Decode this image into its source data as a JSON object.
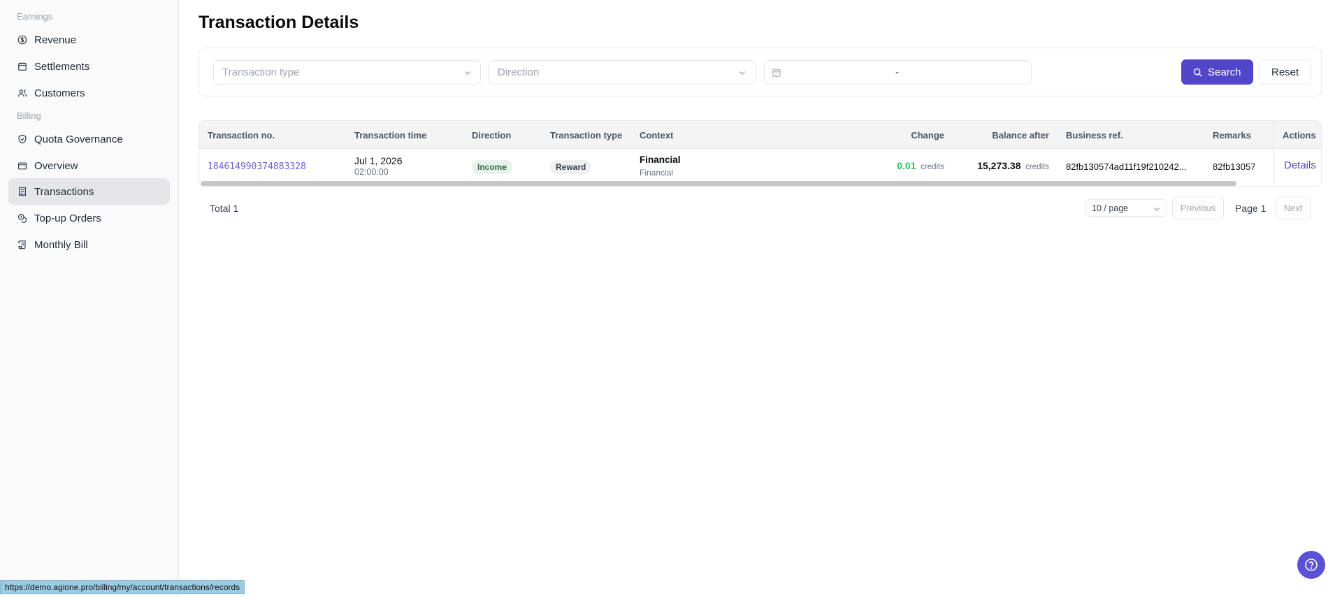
{
  "sidebar": {
    "sections": [
      {
        "label": "Earnings",
        "items": [
          {
            "label": "Revenue",
            "icon": "dollar-circle-icon"
          },
          {
            "label": "Settlements",
            "icon": "calendar-icon"
          },
          {
            "label": "Customers",
            "icon": "users-icon"
          }
        ]
      },
      {
        "label": "Billing",
        "items": [
          {
            "label": "Quota Governance",
            "icon": "shield-check-icon"
          },
          {
            "label": "Overview",
            "icon": "wallet-icon"
          },
          {
            "label": "Transactions",
            "icon": "receipt-icon",
            "active": true
          },
          {
            "label": "Top-up Orders",
            "icon": "coins-icon"
          },
          {
            "label": "Monthly Bill",
            "icon": "scroll-icon"
          }
        ]
      }
    ]
  },
  "page": {
    "title": "Transaction Details"
  },
  "filters": {
    "transaction_type_placeholder": "Transaction type",
    "direction_placeholder": "Direction",
    "date_separator": "-",
    "search_label": "Search",
    "reset_label": "Reset"
  },
  "table": {
    "headers": {
      "no": "Transaction no.",
      "time": "Transaction time",
      "direction": "Direction",
      "type": "Transaction type",
      "context": "Context",
      "change": "Change",
      "balance": "Balance after",
      "business_ref": "Business ref.",
      "remarks": "Remarks",
      "actions": "Actions"
    },
    "rows": [
      {
        "no": "184614990374883328",
        "date": "Jul 1, 2026",
        "time": "02:00:00",
        "direction": "Income",
        "type": "Reward",
        "context_title": "Financial",
        "context_sub": "Financial",
        "change": "0.01",
        "change_unit": "credits",
        "balance": "15,273.38",
        "balance_unit": "credits",
        "business_ref": "82fb130574ad11f19f210242...",
        "remarks": "82fb13057",
        "action": "Details"
      }
    ]
  },
  "pagination": {
    "total": "Total 1",
    "page_size": "10 / page",
    "previous": "Previous",
    "page": "Page 1",
    "next": "Next"
  },
  "status_url": "https://demo.agione.pro/billing/my/account/transactions/records",
  "colors": {
    "accent": "#5146c8",
    "link": "#6a5fd6",
    "positive": "#22c55e",
    "income_bg": "#e8f1ec"
  }
}
